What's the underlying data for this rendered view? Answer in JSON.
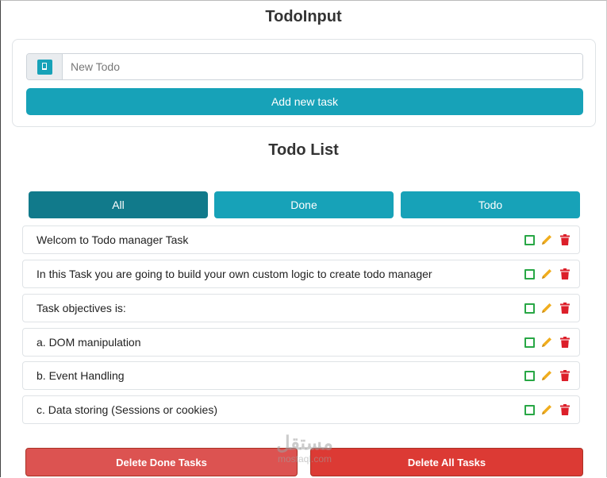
{
  "input_section": {
    "title": "TodoInput",
    "input_placeholder": "New Todo",
    "input_icon": "book-icon",
    "add_button_label": "Add new task"
  },
  "list_section": {
    "title": "Todo List",
    "filters": [
      {
        "label": "All",
        "active": true
      },
      {
        "label": "Done",
        "active": false
      },
      {
        "label": "Todo",
        "active": false
      }
    ],
    "items": [
      {
        "text": "Welcom to Todo manager Task"
      },
      {
        "text": "In this Task you are going to build your own custom logic to create todo manager"
      },
      {
        "text": "Task objectives is:"
      },
      {
        "text": "a. DOM manipulation"
      },
      {
        "text": "b. Event Handling"
      },
      {
        "text": "c. Data storing (Sessions or cookies)"
      }
    ],
    "item_actions": [
      "checkbox-icon",
      "pencil-icon",
      "trash-icon"
    ]
  },
  "footer": {
    "delete_done_label": "Delete Done Tasks",
    "delete_all_label": "Delete All Tasks"
  },
  "watermark": {
    "arabic": "مستقل",
    "latin": "mostaql.com"
  },
  "colors": {
    "primary": "#17a2b8",
    "primary_active": "#117a8b",
    "success": "#28a745",
    "warning": "#f0ad1e",
    "danger": "#dc3545"
  }
}
